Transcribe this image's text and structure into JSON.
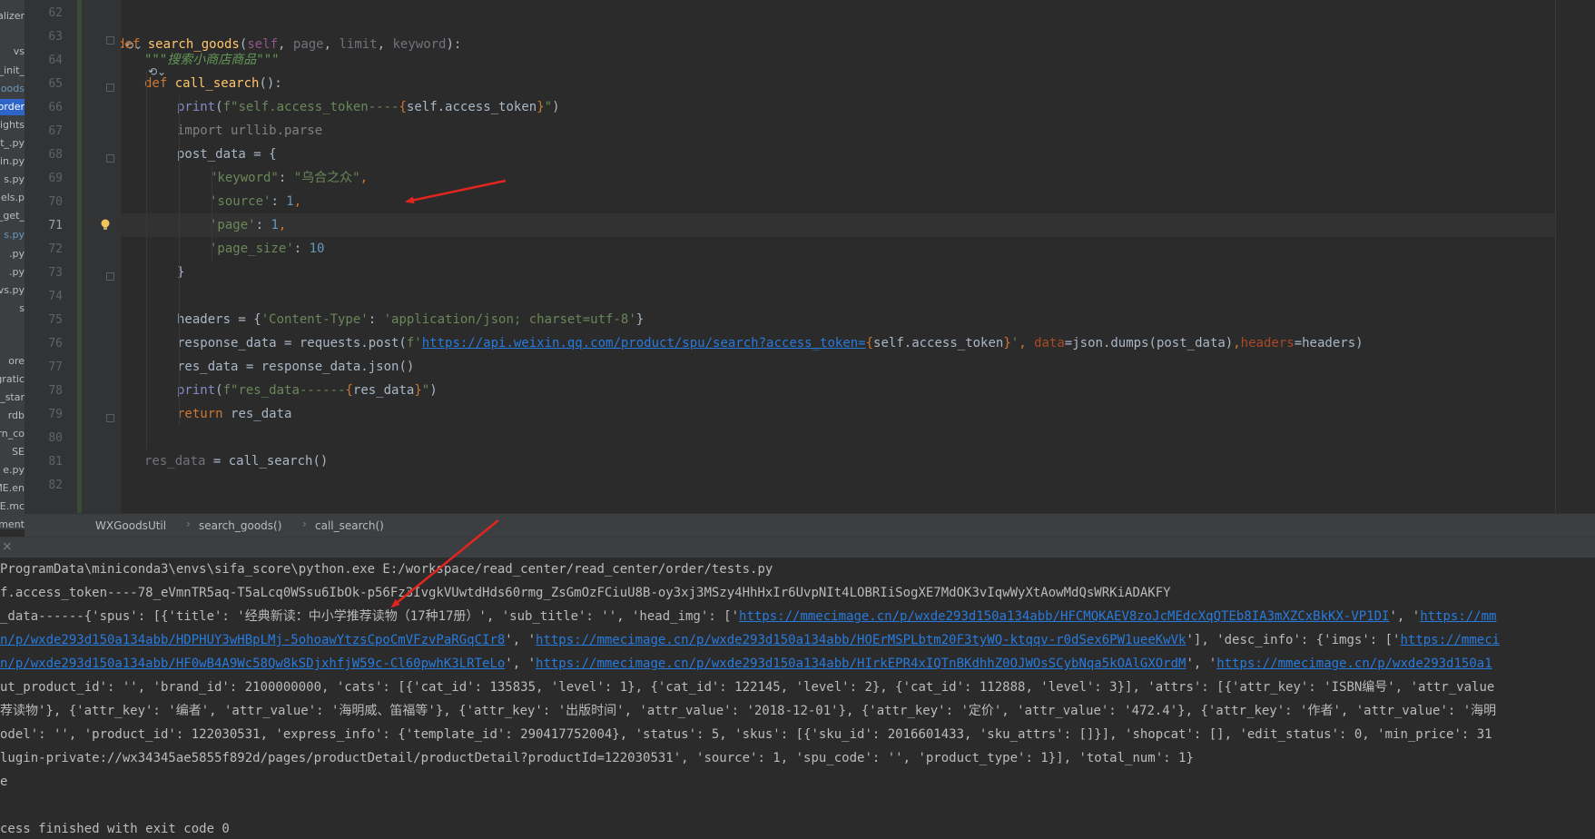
{
  "project_panel": {
    "items": [
      {
        "label": "alizer",
        "style": "normal"
      },
      {
        "label": "vs",
        "style": "normal"
      },
      {
        "label": "_init_",
        "style": "normal"
      },
      {
        "label": "goods",
        "style": "hl"
      },
      {
        "label": "order",
        "style": "sel"
      },
      {
        "label": "ights",
        "style": "normal"
      },
      {
        "label": "t_.py",
        "style": "normal"
      },
      {
        "label": "nin.py",
        "style": "normal"
      },
      {
        "label": "s.py",
        "style": "normal"
      },
      {
        "label": "dels.p",
        "style": "normal"
      },
      {
        "label": "_get_",
        "style": "normal"
      },
      {
        "label": "s.py",
        "style": "hl"
      },
      {
        "label": ".py",
        "style": "normal"
      },
      {
        "label": ".py",
        "style": "normal"
      },
      {
        "label": "vs.py",
        "style": "normal"
      },
      {
        "label": "s",
        "style": "normal"
      },
      {
        "label": "ore",
        "style": "normal"
      },
      {
        "label": "gratic",
        "style": "normal"
      },
      {
        "label": "_star",
        "style": "normal"
      },
      {
        "label": "rdb",
        "style": "normal"
      },
      {
        "label": "rn_co",
        "style": "normal"
      },
      {
        "label": "SE",
        "style": "normal"
      },
      {
        "label": "e.py",
        "style": "normal"
      },
      {
        "label": "ME.en",
        "style": "normal"
      },
      {
        "label": "ME.mc",
        "style": "normal"
      },
      {
        "label": "ement",
        "style": "normal"
      }
    ]
  },
  "editor": {
    "line_numbers": [
      "62",
      "63",
      "64",
      "65",
      "66",
      "67",
      "68",
      "69",
      "70",
      "71",
      "72",
      "73",
      "74",
      "75",
      "76",
      "77",
      "78",
      "79",
      "80",
      "81",
      "82"
    ],
    "current_line": "71",
    "t": {
      "def": "def ",
      "search_goods": "search_goods",
      "open_paren": "(",
      "self": "self",
      "comma_sp": ", ",
      "page": "page",
      "limit": "limit",
      "keyword": "keyword",
      "close_paren_colon": "):",
      "docstring": "\"\"\"搜索小商店商品\"\"\"",
      "call_search": "call_search",
      "empty_parens_colon": "():",
      "print": "print",
      "f_access_prefix": "f\"self.access_token----",
      "lbrace": "{",
      "rbrace": "}",
      "self_access_token": "self.access_token",
      "close_fstring": "\"",
      "rparen": ")",
      "import_urllib": "import urllib.parse",
      "post_data_assign": "post_data = {",
      "keyword_key": "\"keyword\"",
      "colon_sp": ": ",
      "keyword_val": "\"乌合之众\"",
      "comma": ",",
      "source_key": "'source'",
      "one": "1",
      "page_key": "'page'",
      "page_size_key": "'page_size'",
      "ten": "10",
      "close_brace": "}",
      "headers_assign": "headers = {",
      "ct_key": "'Content-Type'",
      "ct_val": "'application/json; charset=utf-8'",
      "resp_assign": "response_data = requests.post(",
      "f_quote": "f'",
      "url": "https://api.weixin.qq.com/product/spu/search?access_token=",
      "close_quote": "'",
      "data_kw": "data",
      "eq_json": "=json.dumps(post_data)",
      "headers_kw": "headers",
      "eq_headers": "=headers)",
      "res_data_var": "res_data",
      "eq_resp_json": " = response_data.json()",
      "f_resdata_prefix": "f\"res_data------",
      "res_data_name": "res_data",
      "return_kw": "return ",
      "call_assign_lhs": "res_data",
      "call_assign_rhs": " = call_search()"
    }
  },
  "breadcrumbs": [
    "WXGoodsUtil",
    "search_goods()",
    "call_search()"
  ],
  "console": {
    "lines": [
      [
        {
          "t": "ProgramData\\miniconda3\\envs\\sifa_score\\python.exe E:/workspace/read_center/read_center/order/tests.py"
        }
      ],
      [
        {
          "t": "f.access_token----78_eVmnTR5aq-T5aLcq0WSsu6IbOk-p56Fz3IvgkVUwtdHds60rmg_ZsGmOzFCiuU8B-oy3xj3MSzy4HhHxIr6UvpNIt4LOBRIiSogXE7MdOK3vIqwWyXtAowMdQsWRKiADAKFY"
        }
      ],
      [
        {
          "t": "_data------{'spus': [{'title': '经典新读：中小学推荐读物（17种17册）', 'sub_title': '', 'head_img': ['"
        },
        {
          "t": "https://mmecimage.cn/p/wxde293d150a134abb/HFCMQKAEV8zoJcMEdcXqQTEb8IA3mXZCxBkKX-VP1DI",
          "link": true
        },
        {
          "t": "', '"
        },
        {
          "t": "https://mm",
          "link": true
        }
      ],
      [
        {
          "t": "n/p/wxde293d150a134abb/HDPHUY3wHBpLMj-5ohoawYtzsCpoCmVFzvPaRGqCIr8",
          "link": true
        },
        {
          "t": "', '"
        },
        {
          "t": "https://mmecimage.cn/p/wxde293d150a134abb/HOErMSPLbtm20F3tyWQ-ktqqv-r0dSex6PW1ueeKwVk",
          "link": true
        },
        {
          "t": "'], 'desc_info': {'imgs': ['"
        },
        {
          "t": "https://mmeci",
          "link": true
        }
      ],
      [
        {
          "t": "n/p/wxde293d150a134abb/HF0wB4A9Wc58Qw8kSDjxhfjW59c-Cl60pwhK3LRTeLo",
          "link": true
        },
        {
          "t": "', '"
        },
        {
          "t": "https://mmecimage.cn/p/wxde293d150a134abb/HIrkEPR4xIQTnBKdhhZ0OJWOsSCybNqa5kOAlGXOrdM",
          "link": true
        },
        {
          "t": "', '"
        },
        {
          "t": "https://mmecimage.cn/p/wxde293d150a1",
          "link": true
        }
      ],
      [
        {
          "t": "ut_product_id': '', 'brand_id': 2100000000, 'cats': [{'cat_id': 135835, 'level': 1}, {'cat_id': 122145, 'level': 2}, {'cat_id': 112888, 'level': 3}], 'attrs': [{'attr_key': 'ISBN编号', 'attr_value"
        }
      ],
      [
        {
          "t": "荐读物'}, {'attr_key': '编者', 'attr_value': '海明威、笛福等'}, {'attr_key': '出版时间', 'attr_value': '2018-12-01'}, {'attr_key': '定价', 'attr_value': '472.4'}, {'attr_key': '作者', 'attr_value': '海明"
        }
      ],
      [
        {
          "t": "odel': '', 'product_id': 122030531, 'express_info': {'template_id': 290417752004}, 'status': 5, 'skus': [{'sku_id': 2016601433, 'sku_attrs': []}], 'shopcat': [], 'edit_status': 0, 'min_price': 31"
        }
      ],
      [
        {
          "t": "lugin-private://wx34345ae5855f892d/pages/productDetail/productDetail?productId=122030531', 'source': 1, 'spu_code': '', 'product_type': 1}], 'total_num': 1}"
        }
      ],
      [
        {
          "t": "e"
        }
      ],
      [
        {
          "t": ""
        }
      ],
      [
        {
          "t": "cess finished with exit code 0"
        }
      ]
    ]
  },
  "colors": {
    "annotation_arrow": "#e0261f",
    "keyword": "#cc7832",
    "function": "#ffc66d",
    "string": "#6a8759",
    "number": "#6897bb",
    "self": "#94558d",
    "link": "#287bde"
  },
  "icons": [
    "fold-marker-icon",
    "lightbulb-icon",
    "close-icon",
    "annotation-arrow"
  ]
}
